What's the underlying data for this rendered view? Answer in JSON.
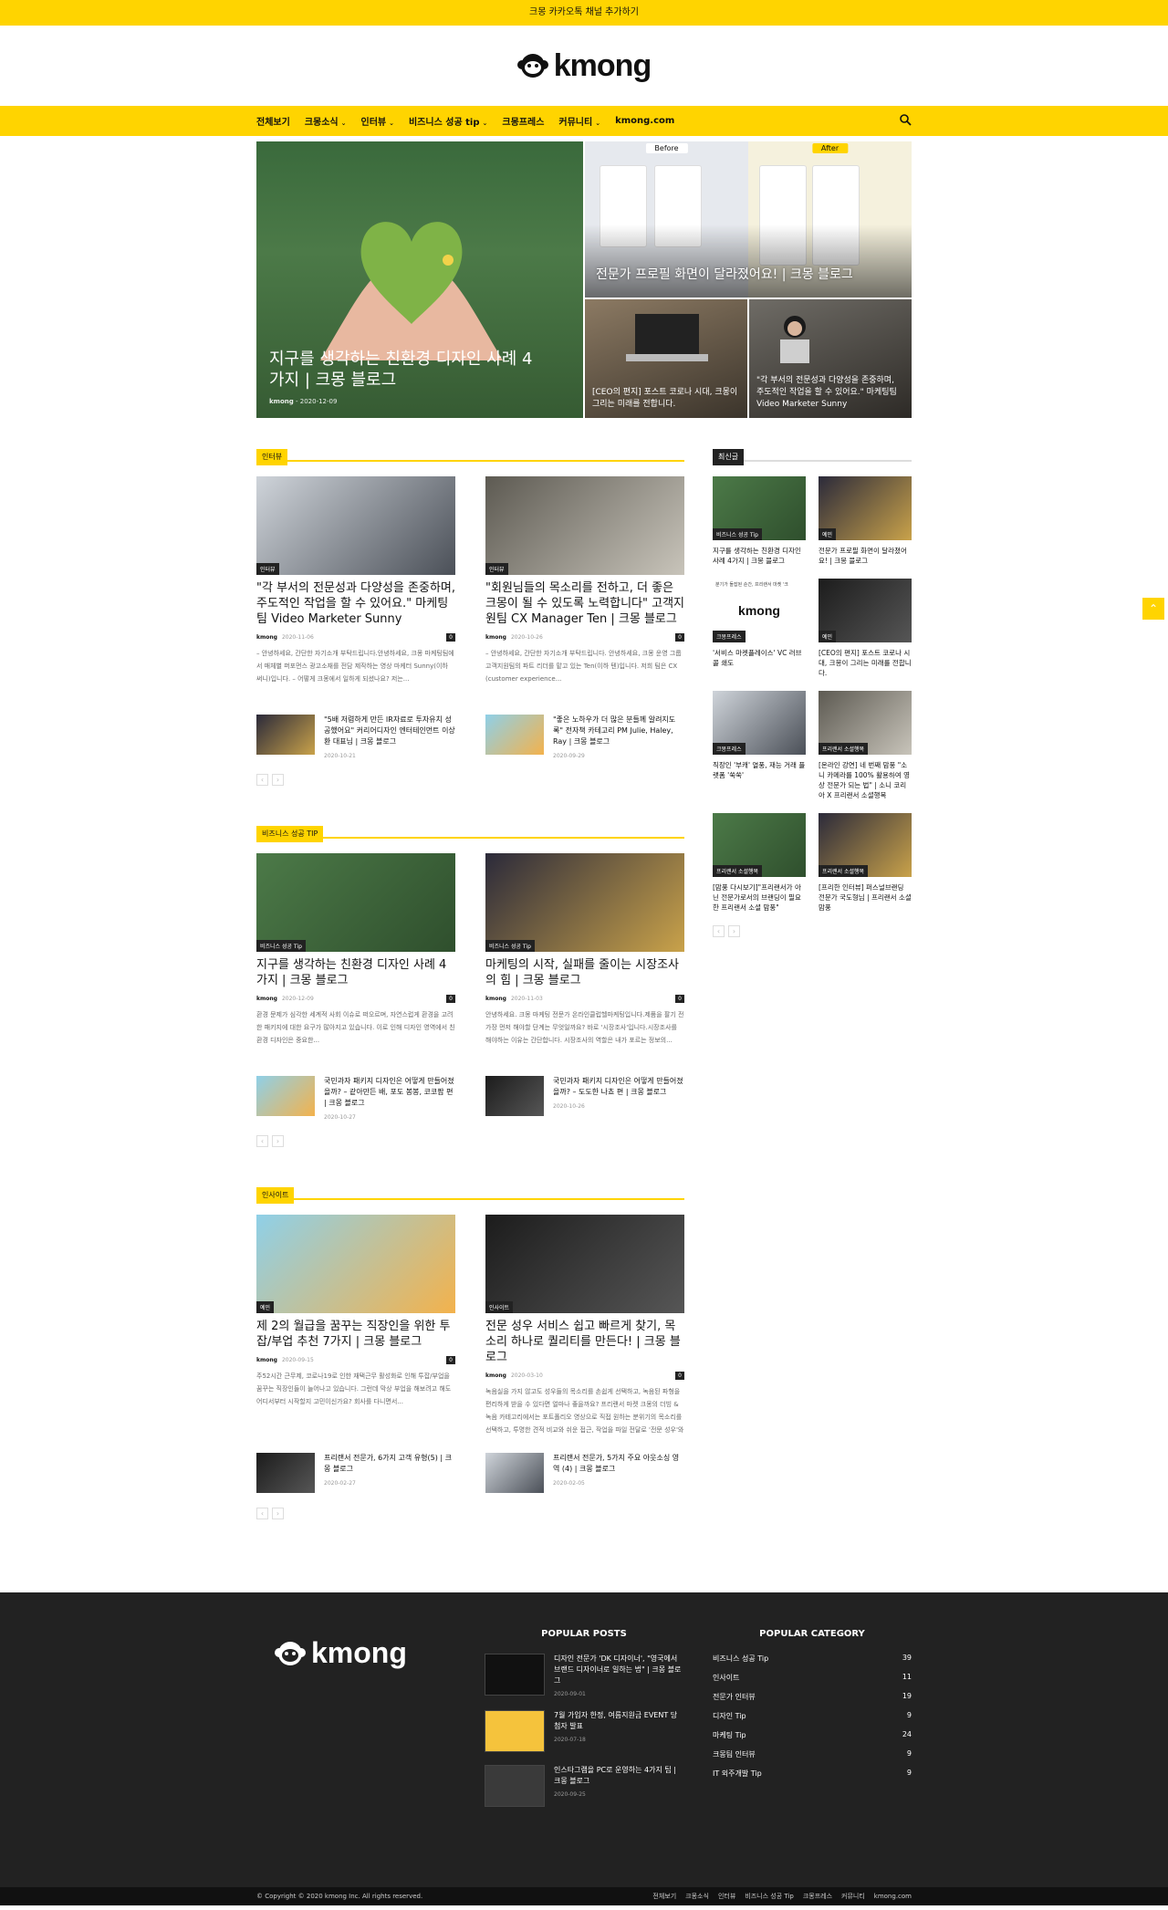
{
  "topbar": {
    "text": "크몽 카카오톡 채널 추가하기"
  },
  "logo": {
    "text": "kmong"
  },
  "nav": {
    "items": [
      {
        "label": "전체보기",
        "chev": false
      },
      {
        "label": "크몽소식",
        "chev": true
      },
      {
        "label": "인터뷰",
        "chev": true
      },
      {
        "label": "비즈니스 성공 tip",
        "chev": true
      },
      {
        "label": "크몽프레스",
        "chev": false
      },
      {
        "label": "커뮤니티",
        "chev": true
      },
      {
        "label": "kmong.com",
        "chev": false
      }
    ]
  },
  "hero": {
    "main": {
      "title": "지구를 생각하는 친환경 디자인 사례 4가지 | 크몽 블로그",
      "author": "kmong",
      "date": "2020-12-09"
    },
    "top_right": {
      "title": "전문가 프로필 화면이 달라졌어요! | 크몽 블로그",
      "before": "Before",
      "after": "After"
    },
    "bottom_left": {
      "title": "[CEO의 편지] 포스트 코로나 시대, 크몽이 그리는 미래를 전합니다."
    },
    "bottom_right": {
      "title": "\"각 부서의 전문성과 다양성을 존중하며, 주도적인 작업을 할 수 있어요.\" 마케팅팀 Video Marketer Sunny"
    }
  },
  "sections": [
    {
      "head": "인터뷰",
      "cards": [
        {
          "tag": "인터뷰",
          "title": "\"각 부서의 전문성과 다양성을 존중하며, 주도적인 작업을 할 수 있어요.\" 마케팅팀 Video Marketer Sunny",
          "author": "kmong",
          "date": "2020-11-06",
          "count": "0",
          "excerpt": "– 안녕하세요, 간단한 자기소개 부탁드립니다.안녕하세요, 크몽 마케팅팀에서 매체별 퍼포먼스 광고소재를 전담 제작하는 영상 마케터 Sunny(이하 써니)입니다. – 어떻게 크몽에서 일하게 되셨나요? 저는..."
        },
        {
          "tag": "인터뷰",
          "title": "\"회원님들의 목소리를 전하고, 더 좋은 크몽이 될 수 있도록 노력합니다\" 고객지원팀 CX Manager Ten | 크몽 블로그",
          "author": "kmong",
          "date": "2020-10-26",
          "count": "0",
          "excerpt": "– 안녕하세요, 간단한 자기소개 부탁드립니다. 안녕하세요, 크몽 운영 그룹 고객지원팀의 파트 리더를 맡고 있는 Ten(이하 텐)입니다. 저희 팀은 CX (customer experience..."
        }
      ],
      "minis": [
        {
          "title": "\"5배 저렴하게 만든 IR자료로 투자유치 성공했어요\" 커리어디자인 엔터테인먼트 이상환 대표님 | 크몽 블로그",
          "date": "2020-10-21"
        },
        {
          "title": "\"좋은 노하우가 더 많은 분들께 알려지도록\" 전자책 카테고리 PM Julie, Haley, Ray | 크몽 블로그",
          "date": "2020-09-29"
        }
      ]
    },
    {
      "head": "비즈니스 성공 TIP",
      "cards": [
        {
          "tag": "비즈니스 성공 Tip",
          "title": "지구를 생각하는 친환경 디자인 사례 4가지 | 크몽 블로그",
          "author": "kmong",
          "date": "2020-12-09",
          "count": "0",
          "excerpt": "환경 문제가 심각한 세계적 사회 이슈로 떠오르며, 자연스럽게 환경을 고려한 패키지에 대한 요구가 많아지고 있습니다. 이로 인해 디자인 영역에서 친환경 디자인은 중요한..."
        },
        {
          "tag": "비즈니스 성공 Tip",
          "title": "마케팅의 시작, 실패를 줄이는 시장조사의 힘 | 크몽 블로그",
          "author": "kmong",
          "date": "2020-11-03",
          "count": "0",
          "excerpt": "안녕하세요. 크몽 마케팅 전문가 온라인클럽헬마케팅입니다.제품을 팔기 전 가장 먼저 해야할 단계는 무엇일까요? 바로 '시장조사'입니다.시장조사를 해야하는 이유는 간단합니다. 시장조사의 역할은 내가 포르는 정보의..."
        }
      ],
      "minis": [
        {
          "title": "국민과자 패키지 디자인은 어떻게 만들어졌을까? – 같아만든 배, 포도 봉봉, 코코팜 편 | 크몽 블로그",
          "date": "2020-10-27"
        },
        {
          "title": "국민과자 패키지 디자인은 어떻게 만들어졌을까? – 도도한 나쵸 편 | 크몽 블로그",
          "date": "2020-10-26"
        }
      ]
    },
    {
      "head": "인사이트",
      "cards": [
        {
          "tag": "예민",
          "title": "제 2의 월급을 꿈꾸는 직장인을 위한 투잡/부업 추천 7가지 | 크몽 블로그",
          "author": "kmong",
          "date": "2020-09-15",
          "count": "0",
          "excerpt": "주52시간 근무제, 코로나19로 인한 재택근무 활성화로 인해 투잡/부업을 꿈꾸는 직장인들이 늘어나고 있습니다. 그런데 막상 부업을 해보려고 해도 어디서부터 시작할지 고민이신가요? 회사를 다니면서..."
        },
        {
          "tag": "인사이트",
          "title": "전문 성우 서비스 쉽고 빠르게 찾기, 목소리 하나로 퀄리티를 만든다! | 크몽 블로그",
          "author": "kmong",
          "date": "2020-03-10",
          "count": "0",
          "excerpt": "녹음실을 가지 않고도 성우들의 목소리를 손쉽게 선택하고, 녹음된 파형을 편리하게 받을 수 있다면 얼마나 좋을까요? 프리랜서 마켓 크몽의 더빙 & 녹음 카테고리에서는 포트폴리오 영상으로 직접 원하는 분위기의 목소리를 선택하고, 투명한 견적 비교와 쉬운 접근, 작업을 파일 전달로 '전문 성우'와 비대면 거래가 가능합니다."
        }
      ],
      "minis": [
        {
          "title": "프리랜서 전문가, 6가지 고객 유형(5) | 크몽 블로그",
          "date": "2020-02-27"
        },
        {
          "title": "프리랜서 전문가, 5가지 주요 아웃소싱 영역 (4) | 크몽 블로그",
          "date": "2020-02-05"
        }
      ]
    }
  ],
  "sidebar": {
    "head": "최신글",
    "items": [
      {
        "tag": "비즈니스 성공 Tip",
        "title": "지구를 생각하는 친환경 디자인 사례 4가지 | 크몽 블로그"
      },
      {
        "tag": "예민",
        "title": "전문가 프로필 화면이 달라졌어요! | 크몽 블로그"
      },
      {
        "tag": "크몽프레스",
        "title": "'서비스 마켓플레이스' VC 러브콜 쇄도",
        "thumb_text": "분기가 돌잡된 순간, 프리랜서 마켓 '크",
        "logo": "kmong"
      },
      {
        "tag": "예민",
        "title": "[CEO의 편지] 포스트 코로나 시대, 크몽이 그리는 미래를 전합니다."
      },
      {
        "tag": "크몽프레스",
        "title": "직장인 '부캐' 열풍, 재능 거래 플랫폼 '쑥쑥'"
      },
      {
        "tag": "프리랜서 소셜행복",
        "title": "[온라인 강연] 네 번째 맘풍 \"소니 카메라를 100% 활용하여 영상 전문가 되는 법\" | 소니 코리아 X 프리랜서 소셜행복"
      },
      {
        "tag": "프리랜서 소셜행복",
        "title": "[맘풍 다시보기]\"프리랜서가 아닌 전문가로서의 브랜딩이 필요한 프리랜서 소셜 맘풍\""
      },
      {
        "tag": "프리랜서 소셜행복",
        "title": "[프리한 인터뷰] 퍼스널브랜딩 전문가 국도형님 | 프리랜서 소셜맘풍"
      }
    ]
  },
  "footer": {
    "logo": "kmong",
    "popular_posts_head": "POPULAR POSTS",
    "popular_posts": [
      {
        "title": "디자인 전문가 'DK 디자이너', \"영국에서 브랜드 디자이너로 일하는 법\" | 크몽 블로그",
        "date": "2020-09-01"
      },
      {
        "title": "7월 가입자 한정, 여름지원금 EVENT 당첨자 발표",
        "date": "2020-07-18"
      },
      {
        "title": "인스타그램을 PC로 운영하는 4가지 팁 | 크몽 블로그",
        "date": "2020-09-25"
      }
    ],
    "popular_category_head": "POPULAR CATEGORY",
    "categories": [
      {
        "name": "비즈니스 성공 Tip",
        "count": "39"
      },
      {
        "name": "인사이트",
        "count": "11"
      },
      {
        "name": "전문가 인터뷰",
        "count": "19"
      },
      {
        "name": "디자인 Tip",
        "count": "9"
      },
      {
        "name": "마케팅 Tip",
        "count": "24"
      },
      {
        "name": "크몽팀 인터뷰",
        "count": "9"
      },
      {
        "name": "IT 외주개발 Tip",
        "count": "9"
      }
    ]
  },
  "bottom": {
    "copyright": "© Copyright © 2020 kmong Inc. All rights reserved.",
    "links": [
      "전체보기",
      "크몽소식",
      "인터뷰",
      "비즈니스 성공 Tip",
      "크몽프레스",
      "커뮤니티",
      "kmong.com"
    ]
  },
  "colors": {
    "brand": "#ffd400",
    "dark": "#222222"
  }
}
